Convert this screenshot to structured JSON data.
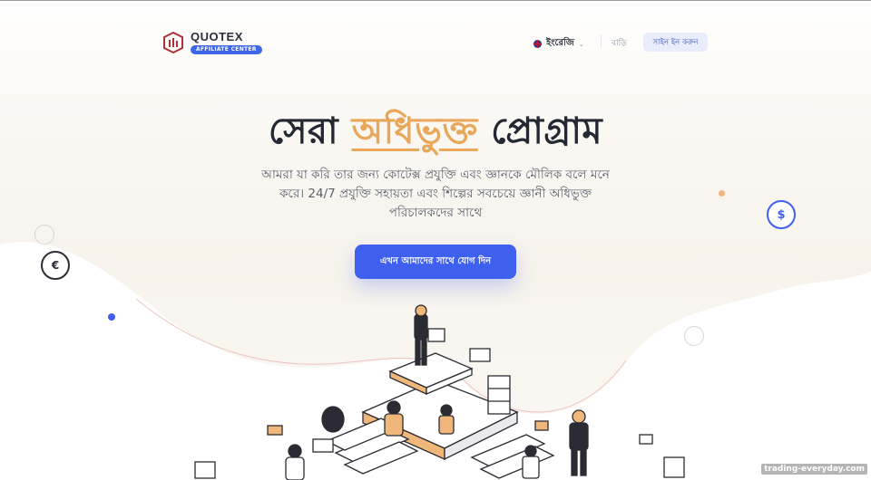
{
  "header": {
    "logo_title": "QUOTEX",
    "logo_badge": "AFFILIATE CENTER",
    "language": "ইংরেজি",
    "home_link": "বাড়ি",
    "signin_button": "সাইন ইন করুন"
  },
  "hero": {
    "title_part1": "সেরা",
    "title_accent": "অধিভুক্ত",
    "title_part2": "প্রোগ্রাম",
    "subtitle": "আমরা যা করি তার জন্য কোটেক্স প্রযুক্তি এবং জ্ঞানকে মৌলিক বলে মনে করে। 24/7 প্রযুক্তি সহায়তা এবং শিল্পের সবচেয়ে জ্ঞানী অধিভুক্ত পরিচালকদের সাথে",
    "cta_button": "এখন আমাদের সাথে যোগ দিন"
  },
  "decor": {
    "coin_euro": "€",
    "coin_dollar": "$"
  },
  "watermark": "trading-everyday.com",
  "colors": {
    "accent_blue": "#3f60ee",
    "accent_orange": "#e9a75a",
    "logo_red": "#b0303a",
    "text_dark": "#242833"
  }
}
